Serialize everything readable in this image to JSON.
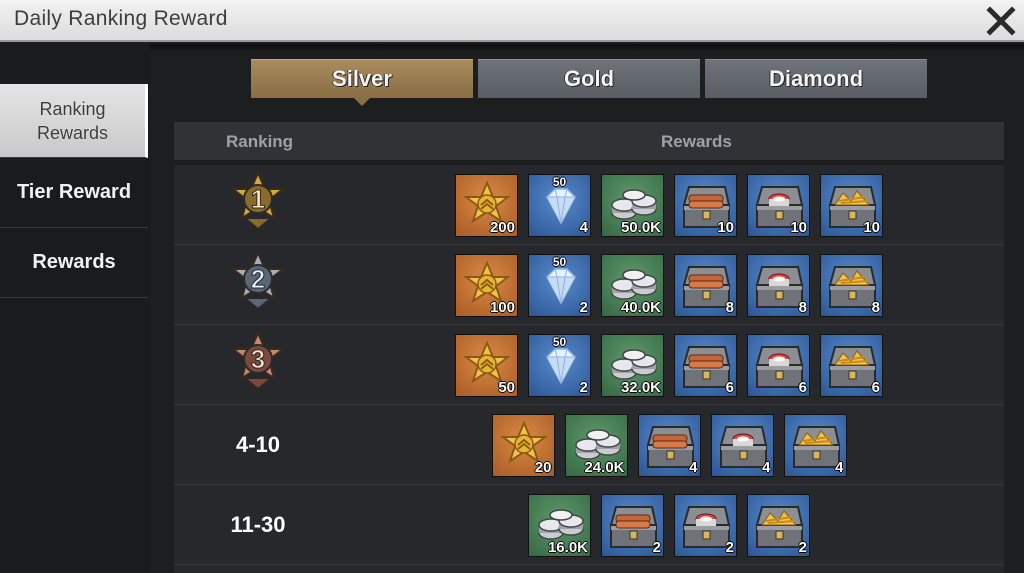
{
  "header": {
    "title": "Daily Ranking Reward"
  },
  "sidebar": {
    "items": [
      {
        "label": "Ranking Rewards",
        "active": true
      },
      {
        "label": "Tier Reward",
        "active": false
      },
      {
        "label": "Rewards",
        "active": false
      }
    ]
  },
  "tabs": [
    {
      "label": "Silver",
      "active": true
    },
    {
      "label": "Gold",
      "active": false
    },
    {
      "label": "Diamond",
      "active": false
    }
  ],
  "table": {
    "headers": {
      "ranking": "Ranking",
      "rewards": "Rewards"
    },
    "rows": [
      {
        "rank": "1",
        "medal": "gold-medal",
        "rewards": [
          {
            "type": "badge",
            "qty": "200"
          },
          {
            "type": "diamond",
            "tag": "50",
            "qty": "4"
          },
          {
            "type": "silver",
            "qty": "50.0K"
          },
          {
            "type": "wood-chest",
            "qty": "10"
          },
          {
            "type": "food-chest",
            "qty": "10"
          },
          {
            "type": "gold-chest",
            "qty": "10"
          }
        ]
      },
      {
        "rank": "2",
        "medal": "silver-medal",
        "rewards": [
          {
            "type": "badge",
            "qty": "100"
          },
          {
            "type": "diamond",
            "tag": "50",
            "qty": "2"
          },
          {
            "type": "silver",
            "qty": "40.0K"
          },
          {
            "type": "wood-chest",
            "qty": "8"
          },
          {
            "type": "food-chest",
            "qty": "8"
          },
          {
            "type": "gold-chest",
            "qty": "8"
          }
        ]
      },
      {
        "rank": "3",
        "medal": "bronze-medal",
        "rewards": [
          {
            "type": "badge",
            "qty": "50"
          },
          {
            "type": "diamond",
            "tag": "50",
            "qty": "2"
          },
          {
            "type": "silver",
            "qty": "32.0K"
          },
          {
            "type": "wood-chest",
            "qty": "6"
          },
          {
            "type": "food-chest",
            "qty": "6"
          },
          {
            "type": "gold-chest",
            "qty": "6"
          }
        ]
      },
      {
        "rank": "4-10",
        "medal": null,
        "rewards": [
          {
            "type": "badge",
            "qty": "20"
          },
          {
            "type": "silver",
            "qty": "24.0K"
          },
          {
            "type": "wood-chest",
            "qty": "4"
          },
          {
            "type": "food-chest",
            "qty": "4"
          },
          {
            "type": "gold-chest",
            "qty": "4"
          }
        ]
      },
      {
        "rank": "11-30",
        "medal": null,
        "rewards": [
          {
            "type": "silver",
            "qty": "16.0K"
          },
          {
            "type": "wood-chest",
            "qty": "2"
          },
          {
            "type": "food-chest",
            "qty": "2"
          },
          {
            "type": "gold-chest",
            "qty": "2"
          }
        ]
      }
    ]
  },
  "colors": {
    "tab_active": "#9c7f52",
    "tab_inactive": "#62676e",
    "tile_orange": "#c27436",
    "tile_blue": "#3f6fb0",
    "tile_green": "#4b8257"
  }
}
